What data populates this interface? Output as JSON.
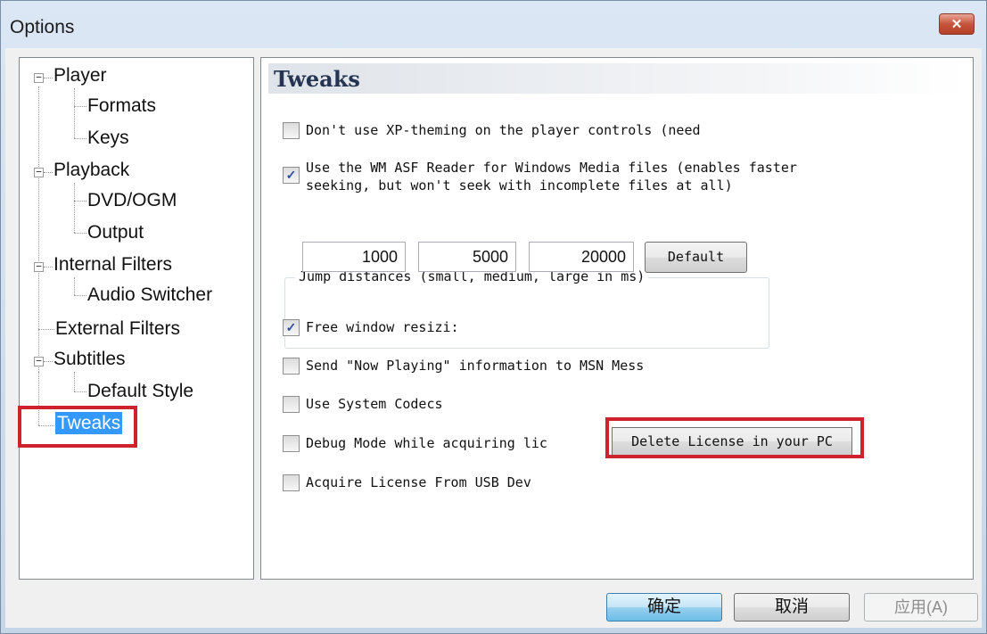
{
  "window": {
    "title": "Options",
    "close_glyph": "✕"
  },
  "tree": {
    "items": [
      {
        "label": "Player",
        "expander": "−"
      },
      {
        "label": "Formats"
      },
      {
        "label": "Keys"
      },
      {
        "label": "Playback",
        "expander": "−"
      },
      {
        "label": "DVD/OGM"
      },
      {
        "label": "Output"
      },
      {
        "label": "Internal Filters",
        "expander": "−"
      },
      {
        "label": "Audio Switcher"
      },
      {
        "label": "External Filters"
      },
      {
        "label": "Subtitles",
        "expander": "−"
      },
      {
        "label": "Default Style"
      },
      {
        "label": "Tweaks",
        "selected": true
      }
    ]
  },
  "panel": {
    "title": "Tweaks",
    "options": {
      "xp_theming": {
        "label": "Don't use XP-theming on the player controls (need",
        "checked": false
      },
      "wm_asf": {
        "label_line1": "Use the WM ASF Reader for Windows Media files (enables faster",
        "label_line2": "seeking, but won't seek with incomplete files at all)",
        "checked": true
      },
      "free_resize": {
        "label": "Free window resizi:",
        "checked": true
      },
      "msn": {
        "label": "Send \"Now Playing\" information to MSN Mess",
        "checked": false
      },
      "system_codecs": {
        "label": "Use System Codecs",
        "checked": false
      },
      "debug_mode": {
        "label": "Debug Mode while acquiring lic",
        "checked": false
      },
      "usb_license": {
        "label": "Acquire License From USB Dev",
        "checked": false
      }
    },
    "jump": {
      "label": "Jump distances (small, medium, large in ms)",
      "small": "1000",
      "medium": "5000",
      "large": "20000",
      "default_button": "Default"
    },
    "delete_license_button": "Delete License in your PC",
    "check_glyph": "✓"
  },
  "footer": {
    "ok": "确定",
    "cancel": "取消",
    "apply": "应用(A)"
  },
  "colors": {
    "highlight": "#d0222e",
    "selection": "#3399ff",
    "check": "#2f4ea0"
  }
}
